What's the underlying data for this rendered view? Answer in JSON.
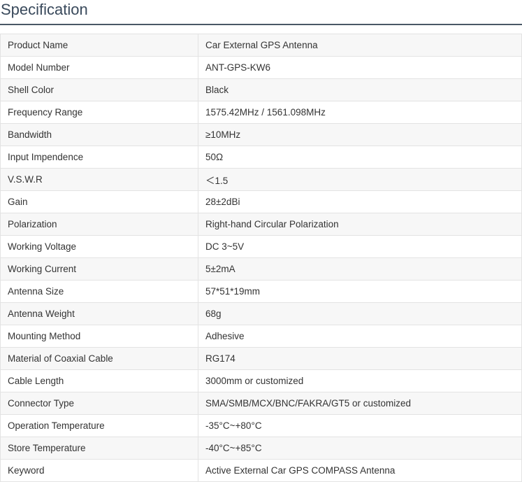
{
  "title": "Specification",
  "rows": [
    {
      "label": "Product Name",
      "value": "Car External GPS Antenna"
    },
    {
      "label": "Model Number",
      "value": "ANT-GPS-KW6"
    },
    {
      "label": "Shell Color",
      "value": "Black"
    },
    {
      "label": "Frequency Range",
      "value": "1575.42MHz / 1561.098MHz"
    },
    {
      "label": "Bandwidth",
      "value": "≥10MHz"
    },
    {
      "label": "Input Impendence",
      "value": "50Ω"
    },
    {
      "label": "V.S.W.R",
      "value": "＜1.5"
    },
    {
      "label": "Gain",
      "value": "28±2dBi"
    },
    {
      "label": "Polarization",
      "value": "Right-hand Circular Polarization"
    },
    {
      "label": "Working Voltage",
      "value": "DC 3~5V"
    },
    {
      "label": "Working Current",
      "value": "5±2mA"
    },
    {
      "label": "Antenna Size",
      "value": "57*51*19mm"
    },
    {
      "label": "Antenna Weight",
      "value": "68g"
    },
    {
      "label": "Mounting Method",
      "value": "Adhesive"
    },
    {
      "label": "Material of Coaxial Cable",
      "value": "RG174"
    },
    {
      "label": "Cable Length",
      "value": "3000mm or customized"
    },
    {
      "label": "Connector Type",
      "value": "SMA/SMB/MCX/BNC/FAKRA/GT5 or customized"
    },
    {
      "label": "Operation Temperature",
      "value": "-35°C~+80°C"
    },
    {
      "label": "Store Temperature",
      "value": "-40°C~+85°C"
    },
    {
      "label": "Keyword",
      "value": "Active External Car GPS COMPASS Antenna"
    }
  ]
}
